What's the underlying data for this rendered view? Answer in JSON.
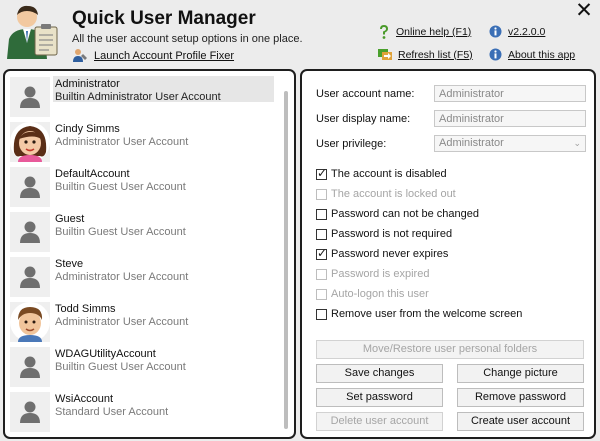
{
  "header": {
    "title": "Quick User Manager",
    "subtitle": "All the user account setup options in one place.",
    "fixer_link": "Launch Account Profile Fixer",
    "online_help": "Online help (F1)",
    "version": "v2.2.0.0",
    "refresh": "Refresh list (F5)",
    "about": "About this app",
    "close": "✕"
  },
  "users": [
    {
      "name": "Administrator",
      "desc": "Builtin Administrator User Account",
      "avatar": "default-avatar",
      "selected": true
    },
    {
      "name": "Cindy Simms",
      "desc": "Administrator User Account",
      "avatar": "woman-avatar",
      "selected": false
    },
    {
      "name": "DefaultAccount",
      "desc": "Builtin Guest User Account",
      "avatar": "default-avatar",
      "selected": false
    },
    {
      "name": "Guest",
      "desc": "Builtin Guest User Account",
      "avatar": "default-avatar",
      "selected": false
    },
    {
      "name": "Steve",
      "desc": "Administrator User Account",
      "avatar": "default-avatar",
      "selected": false
    },
    {
      "name": "Todd Simms",
      "desc": "Administrator User Account",
      "avatar": "man-avatar",
      "selected": false
    },
    {
      "name": "WDAGUtilityAccount",
      "desc": "Builtin Guest User Account",
      "avatar": "default-avatar",
      "selected": false
    },
    {
      "name": "WsiAccount",
      "desc": "Standard User Account",
      "avatar": "default-avatar",
      "selected": false
    }
  ],
  "form": {
    "account_name_label": "User account name:",
    "account_name_value": "Administrator",
    "display_name_label": "User display name:",
    "display_name_value": "Administrator",
    "privilege_label": "User privilege:",
    "privilege_value": "Administrator"
  },
  "options": [
    {
      "label": "The account is disabled",
      "checked": true,
      "disabled": false
    },
    {
      "label": "The account is locked out",
      "checked": false,
      "disabled": true
    },
    {
      "label": "Password can not be changed",
      "checked": false,
      "disabled": false
    },
    {
      "label": "Password is not required",
      "checked": false,
      "disabled": false
    },
    {
      "label": "Password never expires",
      "checked": true,
      "disabled": false
    },
    {
      "label": "Password is expired",
      "checked": false,
      "disabled": true
    },
    {
      "label": "Auto-logon this user",
      "checked": false,
      "disabled": true
    },
    {
      "label": "Remove user from the welcome screen",
      "checked": false,
      "disabled": false
    }
  ],
  "buttons": {
    "move_restore": "Move/Restore user personal folders",
    "save_changes": "Save changes",
    "change_picture": "Change picture",
    "set_password": "Set password",
    "remove_password": "Remove password",
    "delete_account": "Delete user account",
    "create_account": "Create user account"
  },
  "colors": {
    "panel_border": "#1e1e1e",
    "selected_row": "#e6e6e6",
    "disabled_text": "#a5a5a5"
  }
}
